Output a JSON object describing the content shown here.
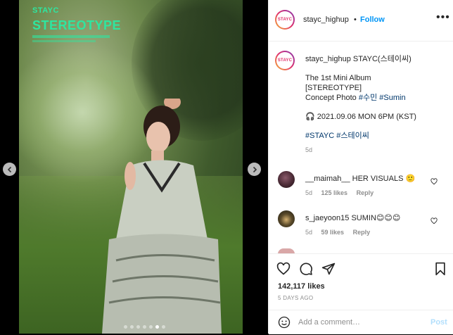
{
  "media": {
    "logo_top": "STAYC",
    "logo_main": "STEREOTYPE",
    "dots": [
      false,
      false,
      false,
      false,
      false,
      true,
      false
    ]
  },
  "post": {
    "header": {
      "avatar_text": "STAYC",
      "username": "stayc_highup",
      "separator": "•",
      "follow_label": "Follow",
      "more_icon": "•••"
    },
    "caption": {
      "avatar_text": "STAYC",
      "username": "stayc_highup",
      "title": "STAYC(스테이씨)",
      "line1": "The 1st Mini Album",
      "line2": "[STEREOTYPE]",
      "line3_prefix": "Concept Photo",
      "tag1": "#수민",
      "tag2": "#Sumin",
      "date_line": "🎧 2021.09.06 MON 6PM (KST)",
      "tag3": "#STAYC",
      "tag4": "#스테이씨",
      "age": "5d"
    },
    "comments": [
      {
        "username": "__maimah__",
        "text": "HER VISUALS 🙂",
        "age": "5d",
        "likes": "125 likes",
        "reply": "Reply"
      },
      {
        "username": "s_jaeyoon15",
        "text": "SUMIN😊😊😊",
        "age": "5d",
        "likes": "59 likes",
        "reply": "Reply"
      }
    ],
    "likes_count": "142,117 likes",
    "time_ago": "5 DAYS AGO",
    "add_comment_placeholder": "Add a comment…",
    "post_label": "Post"
  },
  "colors": {
    "accent": "#0095f6",
    "link": "#00376b",
    "logo": "#2ee6a0"
  }
}
